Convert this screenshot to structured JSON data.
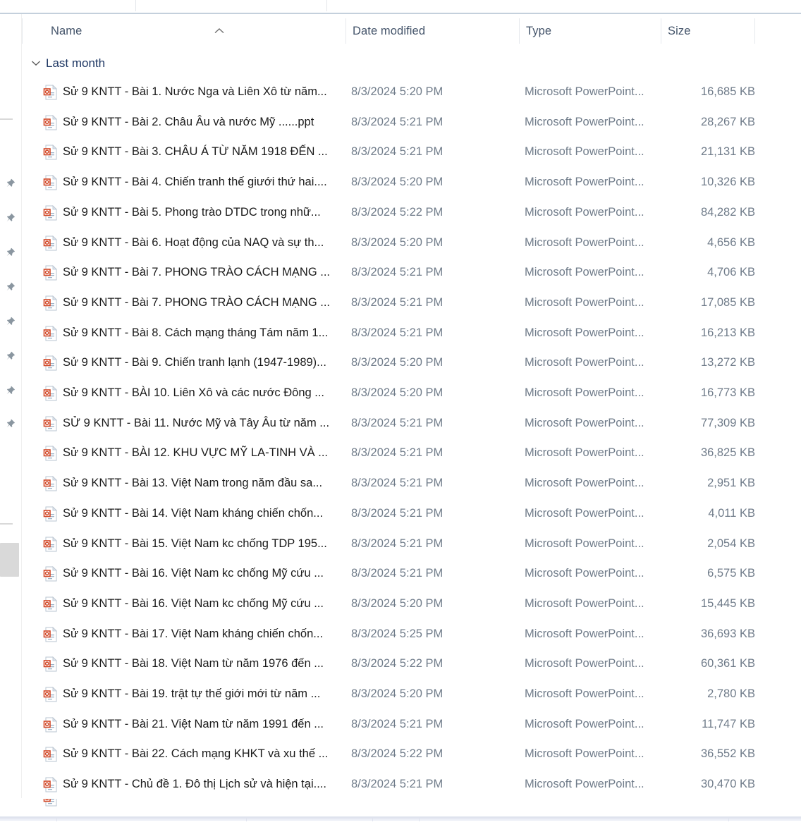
{
  "columns": {
    "name": "Name",
    "date_modified": "Date modified",
    "type": "Type",
    "size": "Size"
  },
  "group": {
    "label": "Last month",
    "expanded": true,
    "chevron_icon": "chevron-down-icon"
  },
  "sort": {
    "column": "Name",
    "direction": "ascending",
    "indicator_icon": "chevron-up-icon"
  },
  "navigation_rail": {
    "pin_icon": "pin-icon",
    "pin_count": 8,
    "scrollbar_visible": true
  },
  "file_icon": "powerpoint-file-icon",
  "files": [
    {
      "name": "Sử 9 KNTT - Bài 1. Nước Nga và Liên Xô từ năm...",
      "date": "8/3/2024 5:20 PM",
      "type": "Microsoft PowerPoint...",
      "size": "16,685 KB"
    },
    {
      "name": "Sử 9 KNTT - Bài 2. Châu Âu và nước Mỹ ......ppt",
      "date": "8/3/2024 5:21 PM",
      "type": "Microsoft PowerPoint...",
      "size": "28,267 KB"
    },
    {
      "name": "Sử 9 KNTT - Bài 3. CHÂU Á TỪ NĂM 1918 ĐẾN ...",
      "date": "8/3/2024 5:21 PM",
      "type": "Microsoft PowerPoint...",
      "size": "21,131 KB"
    },
    {
      "name": "Sử 9 KNTT - Bài 4. Chiến tranh thế giưới thứ hai....",
      "date": "8/3/2024 5:20 PM",
      "type": "Microsoft PowerPoint...",
      "size": "10,326 KB"
    },
    {
      "name": "Sử 9 KNTT - Bài 5. Phong trào DTDC trong nhữ...",
      "date": "8/3/2024 5:22 PM",
      "type": "Microsoft PowerPoint...",
      "size": "84,282 KB"
    },
    {
      "name": "Sử 9 KNTT - Bài 6. Hoạt động của NAQ và sự th...",
      "date": "8/3/2024 5:20 PM",
      "type": "Microsoft PowerPoint...",
      "size": "4,656 KB"
    },
    {
      "name": "Sử 9 KNTT - Bài 7. PHONG TRÀO CÁCH MẠNG ...",
      "date": "8/3/2024 5:21 PM",
      "type": "Microsoft PowerPoint...",
      "size": "4,706 KB"
    },
    {
      "name": "Sử 9 KNTT - Bài 7. PHONG TRÀO CÁCH MẠNG ...",
      "date": "8/3/2024 5:21 PM",
      "type": "Microsoft PowerPoint...",
      "size": "17,085 KB"
    },
    {
      "name": "Sử 9 KNTT - Bài 8. Cách mạng tháng Tám năm 1...",
      "date": "8/3/2024 5:21 PM",
      "type": "Microsoft PowerPoint...",
      "size": "16,213 KB"
    },
    {
      "name": "Sử 9 KNTT - Bài 9. Chiến tranh lạnh (1947-1989)...",
      "date": "8/3/2024 5:20 PM",
      "type": "Microsoft PowerPoint...",
      "size": "13,272 KB"
    },
    {
      "name": "Sử 9 KNTT - BÀI 10. Liên Xô và các nước Đông ...",
      "date": "8/3/2024 5:20 PM",
      "type": "Microsoft PowerPoint...",
      "size": "16,773 KB"
    },
    {
      "name": "SỬ 9 KNTT - Bài 11. Nước Mỹ và Tây Âu từ năm ...",
      "date": "8/3/2024 5:21 PM",
      "type": "Microsoft PowerPoint...",
      "size": "77,309 KB"
    },
    {
      "name": "Sử 9 KNTT - BÀI 12. KHU VỰC MỸ LA-TINH VÀ ...",
      "date": "8/3/2024 5:21 PM",
      "type": "Microsoft PowerPoint...",
      "size": "36,825 KB"
    },
    {
      "name": "Sử 9 KNTT - Bài 13. Việt Nam trong năm đầu sa...",
      "date": "8/3/2024 5:21 PM",
      "type": "Microsoft PowerPoint...",
      "size": "2,951 KB"
    },
    {
      "name": "Sử 9 KNTT - Bài 14. Việt Nam kháng chiến chốn...",
      "date": "8/3/2024 5:21 PM",
      "type": "Microsoft PowerPoint...",
      "size": "4,011 KB"
    },
    {
      "name": "Sử 9 KNTT - Bài 15. Việt Nam kc chống TDP 195...",
      "date": "8/3/2024 5:21 PM",
      "type": "Microsoft PowerPoint...",
      "size": "2,054 KB"
    },
    {
      "name": "Sử 9 KNTT - Bài 16. Việt Nam kc chống Mỹ cứu ...",
      "date": "8/3/2024 5:21 PM",
      "type": "Microsoft PowerPoint...",
      "size": "6,575 KB"
    },
    {
      "name": "Sử 9 KNTT - Bài 16. Việt Nam kc chống Mỹ cứu ...",
      "date": "8/3/2024 5:20 PM",
      "type": "Microsoft PowerPoint...",
      "size": "15,445 KB"
    },
    {
      "name": "Sử 9 KNTT - Bài 17. Việt Nam kháng chiến chốn...",
      "date": "8/3/2024 5:25 PM",
      "type": "Microsoft PowerPoint...",
      "size": "36,693 KB"
    },
    {
      "name": "Sử 9 KNTT - Bài 18. Việt Nam từ năm 1976 đến ...",
      "date": "8/3/2024 5:22 PM",
      "type": "Microsoft PowerPoint...",
      "size": "60,361 KB"
    },
    {
      "name": "Sử 9 KNTT - Bài 19. trật tự thế giới mới từ năm ...",
      "date": "8/3/2024 5:20 PM",
      "type": "Microsoft PowerPoint...",
      "size": "2,780 KB"
    },
    {
      "name": "Sử 9 KNTT - Bài 21. Việt Nam từ năm 1991 đến ...",
      "date": "8/3/2024 5:21 PM",
      "type": "Microsoft PowerPoint...",
      "size": "11,747 KB"
    },
    {
      "name": "Sử 9 KNTT - Bài 22. Cách mạng KHKT và xu thế ...",
      "date": "8/3/2024 5:22 PM",
      "type": "Microsoft PowerPoint...",
      "size": "36,552 KB"
    },
    {
      "name": "Sử 9 KNTT - Chủ đề 1. Đô thị Lịch sử và hiện tại....",
      "date": "8/3/2024 5:21 PM",
      "type": "Microsoft PowerPoint...",
      "size": "30,470 KB"
    }
  ],
  "colors": {
    "text_primary": "#1a1a1a",
    "text_secondary": "#707c8a",
    "header_text": "#44546a",
    "group_text": "#1f3864",
    "rule": "#c4d0dc",
    "powerpoint_orange": "#d24726"
  }
}
